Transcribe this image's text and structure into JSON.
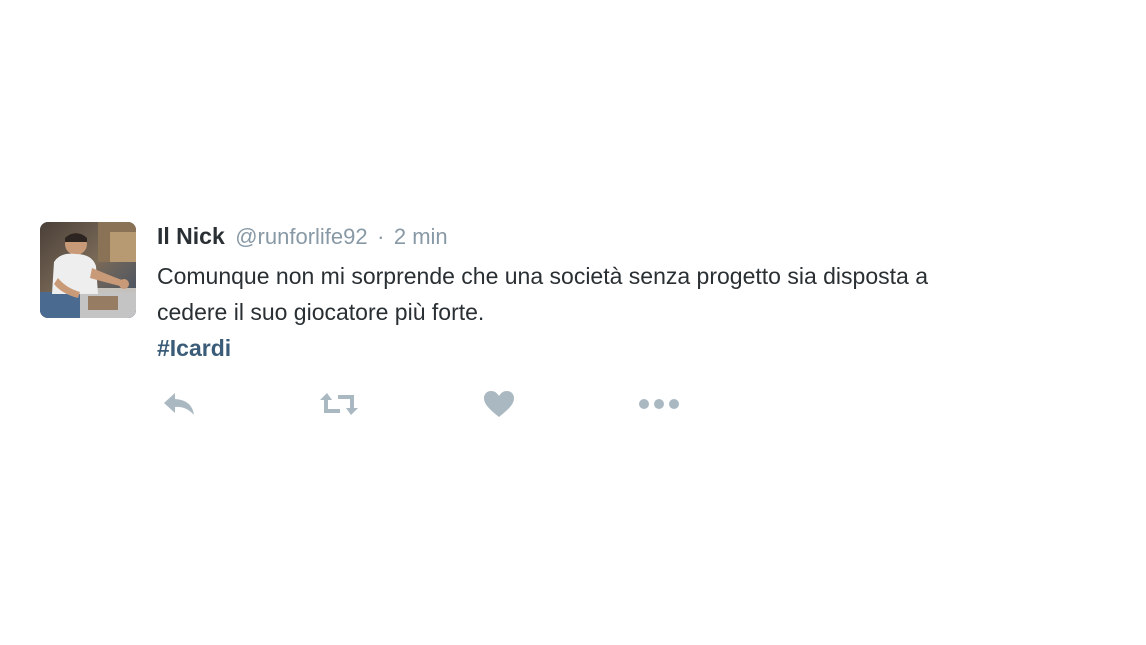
{
  "tweet": {
    "author": {
      "full_name": "Il Nick",
      "username": "@runforlife92"
    },
    "separator": "·",
    "timestamp": "2 min",
    "text_line1": "Comunque non mi sorprende che una società senza progetto sia disposta a",
    "text_line2": "cedere il suo giocatore più forte.",
    "hashtag_symbol": "#",
    "hashtag_text": "Icardi"
  },
  "actions": [
    {
      "name": "reply",
      "icon": "reply-icon"
    },
    {
      "name": "retweet",
      "icon": "retweet-icon"
    },
    {
      "name": "like",
      "icon": "heart-icon"
    },
    {
      "name": "more",
      "icon": "more-dots-icon"
    }
  ],
  "colors": {
    "text": "#292f33",
    "muted": "#8899a6",
    "hashtag": "#3b5c78",
    "action_icon": "#aab8c2"
  }
}
